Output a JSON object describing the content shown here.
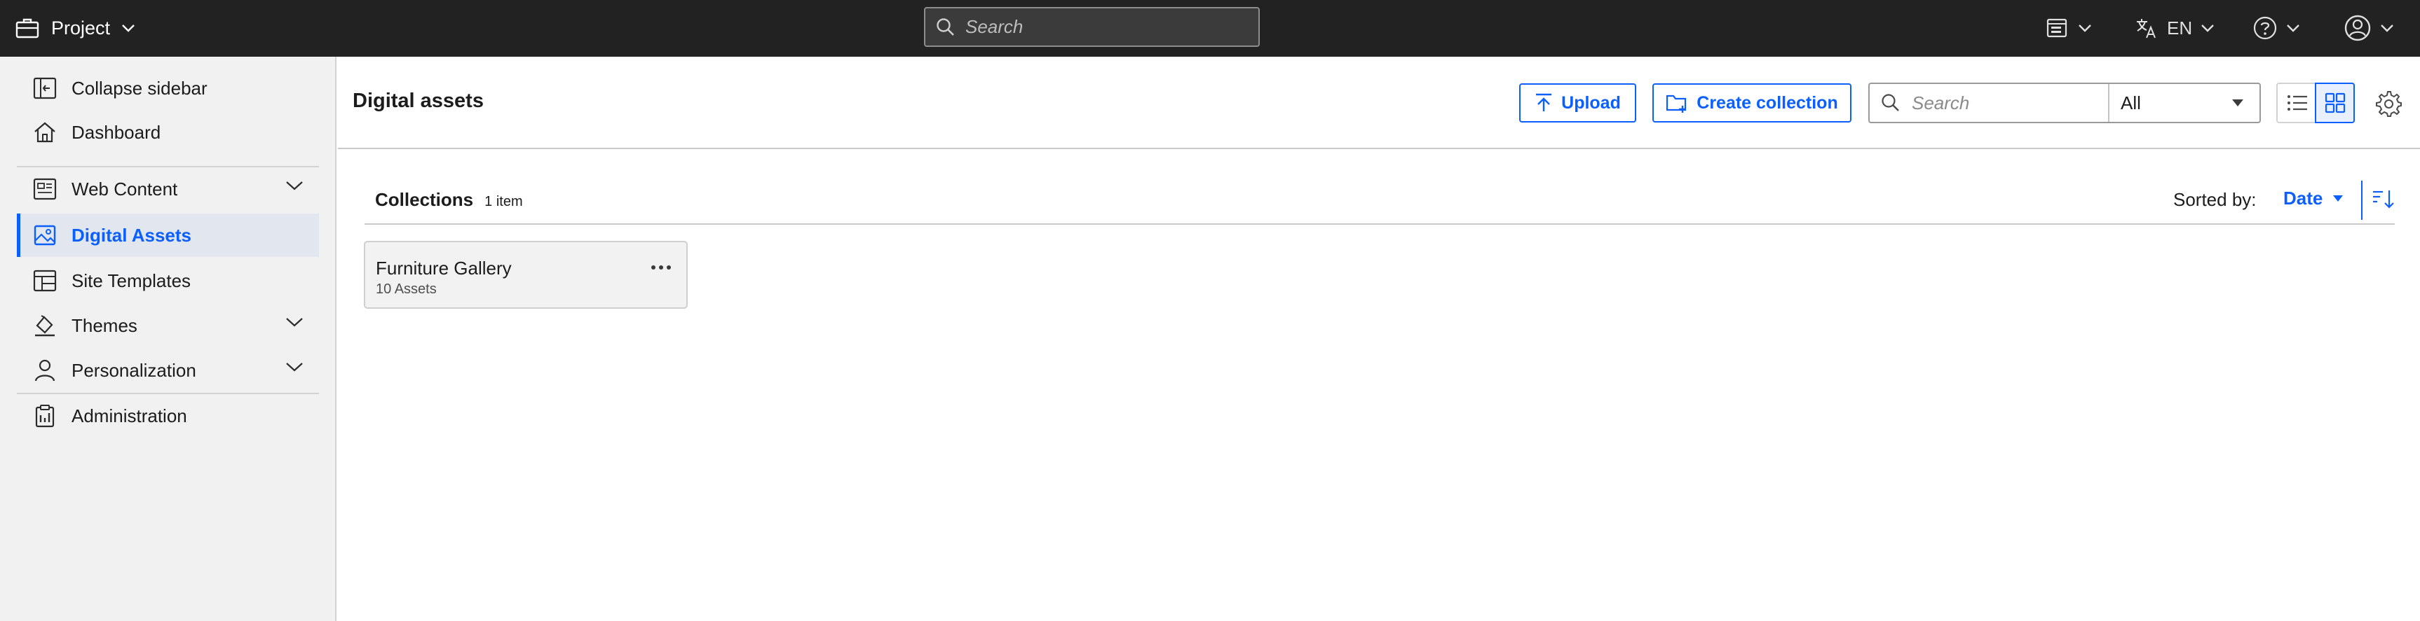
{
  "topbar": {
    "project_label": "Project",
    "search_placeholder": "Search",
    "language": "EN"
  },
  "sidebar": {
    "items": [
      {
        "label": "Collapse sidebar",
        "icon": "collapse-sidebar-icon"
      },
      {
        "label": "Dashboard",
        "icon": "home-icon"
      },
      {
        "label": "Web Content",
        "icon": "web-content-icon",
        "expandable": true
      },
      {
        "label": "Digital Assets",
        "icon": "image-icon",
        "active": true
      },
      {
        "label": "Site Templates",
        "icon": "site-templates-icon"
      },
      {
        "label": "Themes",
        "icon": "paint-bucket-icon",
        "expandable": true
      },
      {
        "label": "Personalization",
        "icon": "user-icon",
        "expandable": true
      },
      {
        "label": "Administration",
        "icon": "clipboard-icon"
      }
    ]
  },
  "header": {
    "title": "Digital assets",
    "upload_label": "Upload",
    "create_collection_label": "Create collection",
    "search_placeholder": "Search",
    "filter_value": "All"
  },
  "collections": {
    "title": "Collections",
    "count": "1 item",
    "sorted_by_label": "Sorted by:",
    "sort_value": "Date",
    "items": [
      {
        "name": "Furniture Gallery",
        "subtitle": "10 Assets"
      }
    ]
  },
  "colors": {
    "accent": "#0b5fff",
    "topbar_bg": "#222222",
    "sidebar_bg": "#f1f1f1",
    "active_bg": "#e2e6ef"
  }
}
